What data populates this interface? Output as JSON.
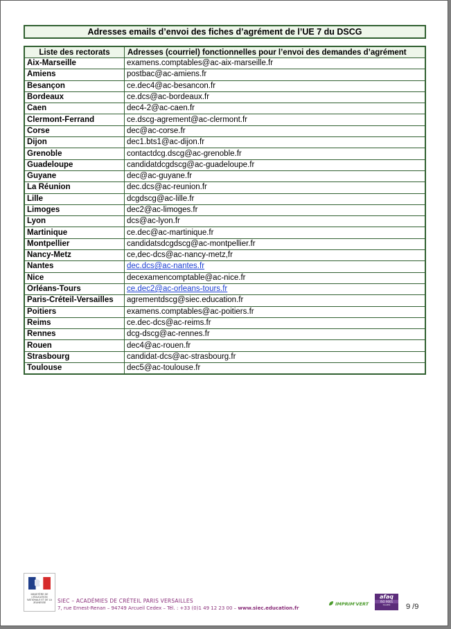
{
  "document": {
    "title": "Adresses emails d’envoi des fiches d’agrément de l’UE 7 du DSCG",
    "table": {
      "headers": [
        "Liste des rectorats",
        "Adresses (courriel) fonctionnelles pour l’envoi des demandes d’agrément"
      ],
      "rows": [
        {
          "rectorat": "Aix-Marseille",
          "email": "examens.comptables@ac-aix-marseille.fr",
          "link": false
        },
        {
          "rectorat": "Amiens",
          "email": "postbac@ac-amiens.fr",
          "link": false
        },
        {
          "rectorat": "Besançon",
          "email": "ce.dec4@ac-besancon.fr",
          "link": false
        },
        {
          "rectorat": "Bordeaux",
          "email": "ce.dcs@ac-bordeaux.fr",
          "link": false
        },
        {
          "rectorat": "Caen",
          "email": "dec4-2@ac-caen.fr",
          "link": false
        },
        {
          "rectorat": "Clermont-Ferrand",
          "email": "ce.dscg-agrement@ac-clermont.fr",
          "link": false
        },
        {
          "rectorat": "Corse",
          "email": "dec@ac-corse.fr",
          "link": false
        },
        {
          "rectorat": "Dijon",
          "email": "dec1.bts1@ac-dijon.fr",
          "link": false
        },
        {
          "rectorat": "Grenoble",
          "email": "contactdcg.dscg@ac-grenoble.fr",
          "link": false
        },
        {
          "rectorat": "Guadeloupe",
          "email": "candidatdcgdscg@ac-guadeloupe.fr",
          "link": false
        },
        {
          "rectorat": "Guyane",
          "email": "dec@ac-guyane.fr",
          "link": false
        },
        {
          "rectorat": "La Réunion",
          "email": "dec.dcs@ac-reunion.fr",
          "link": false
        },
        {
          "rectorat": "Lille",
          "email": "dcgdscg@ac-lille.fr",
          "link": false
        },
        {
          "rectorat": "Limoges",
          "email": "dec2@ac-limoges.fr",
          "link": false
        },
        {
          "rectorat": "Lyon",
          "email": "dcs@ac-lyon.fr",
          "link": false
        },
        {
          "rectorat": "Martinique",
          "email": "ce.dec@ac-martinique.fr",
          "link": false
        },
        {
          "rectorat": "Montpellier",
          "email": "candidatsdcgdscg@ac-montpellier.fr",
          "link": false
        },
        {
          "rectorat": "Nancy-Metz",
          "email": "ce,dec-dcs@ac-nancy-metz,fr",
          "link": false
        },
        {
          "rectorat": "Nantes",
          "email": "dec.dcs@ac-nantes.fr",
          "link": true
        },
        {
          "rectorat": "Nice",
          "email": "decexamencomptable@ac-nice.fr",
          "link": false
        },
        {
          "rectorat": "Orléans-Tours",
          "email": "ce.dec2@ac-orleans-tours.fr",
          "link": true
        },
        {
          "rectorat": "Paris-Créteil-Versailles",
          "email": "agrementdscg@siec.education.fr",
          "link": false
        },
        {
          "rectorat": "Poitiers",
          "email": "examens.comptables@ac-poitiers.fr",
          "link": false
        },
        {
          "rectorat": "Reims",
          "email": "ce.dec-dcs@ac-reims.fr",
          "link": false
        },
        {
          "rectorat": "Rennes",
          "email": "dcg-dscg@ac-rennes.fr",
          "link": false
        },
        {
          "rectorat": "Rouen",
          "email": "dec4@ac-rouen.fr",
          "link": false
        },
        {
          "rectorat": "Strasbourg",
          "email": "candidat-dcs@ac-strasbourg.fr",
          "link": false
        },
        {
          "rectorat": "Toulouse",
          "email": "dec5@ac-toulouse.fr",
          "link": false
        }
      ]
    }
  },
  "footer": {
    "ministry": "MINISTÈRE DE L'ÉDUCATION NATIONALE ET DE LA JEUNESSE",
    "line1": "SIEC – ACADÉMIES DE CRÉTEIL PARIS VERSAILLES",
    "address": "7, rue Ernest-Renan – 94749 Arcueil Cedex – Tél. : +33 (0)1 49 12 23 00 – ",
    "website": "www.siec.education.fr",
    "imprim_vert": "IMPRIM'VERT",
    "afaq": "afaq",
    "afaq_iso": "ISO 9001",
    "afaq_sub": "Qualité",
    "page_number": "9 /9"
  },
  "colors": {
    "border_green": "#2f5f2f",
    "header_fill": "#eef6ea",
    "link_blue": "#1a3fd1",
    "footer_purple": "#8a2f7a",
    "afaq_purple": "#5b2c7a"
  }
}
